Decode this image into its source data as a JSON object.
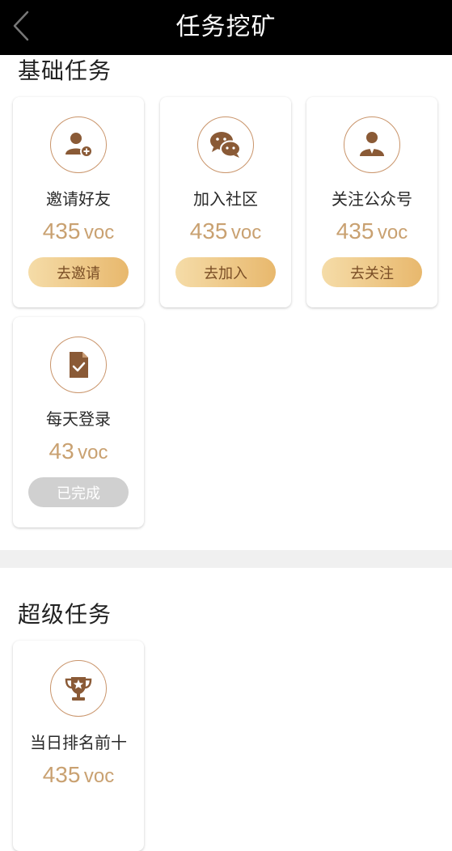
{
  "header": {
    "title": "任务挖矿"
  },
  "basic_section": {
    "title": "基础任务",
    "tasks": [
      {
        "label": "邀请好友",
        "amount": "435",
        "unit": "voc",
        "action": "去邀请",
        "icon": "add-user-icon"
      },
      {
        "label": "加入社区",
        "amount": "435",
        "unit": "voc",
        "action": "去加入",
        "icon": "wechat-icon"
      },
      {
        "label": "关注公众号",
        "amount": "435",
        "unit": "voc",
        "action": "去关注",
        "icon": "official-account-icon"
      },
      {
        "label": "每天登录",
        "amount": "43",
        "unit": "voc",
        "action": "已完成",
        "icon": "checked-document-icon"
      }
    ]
  },
  "super_section": {
    "title": "超级任务",
    "tasks": [
      {
        "label": "当日排名前十",
        "amount": "435",
        "unit": "voc",
        "icon": "trophy-icon"
      }
    ]
  },
  "colors": {
    "accent": "#c9a171",
    "button_gradient_start": "#f5dca8",
    "button_gradient_end": "#e8b86d",
    "icon_brown": "#8a5a36",
    "done_gray": "#d0d0d0"
  }
}
